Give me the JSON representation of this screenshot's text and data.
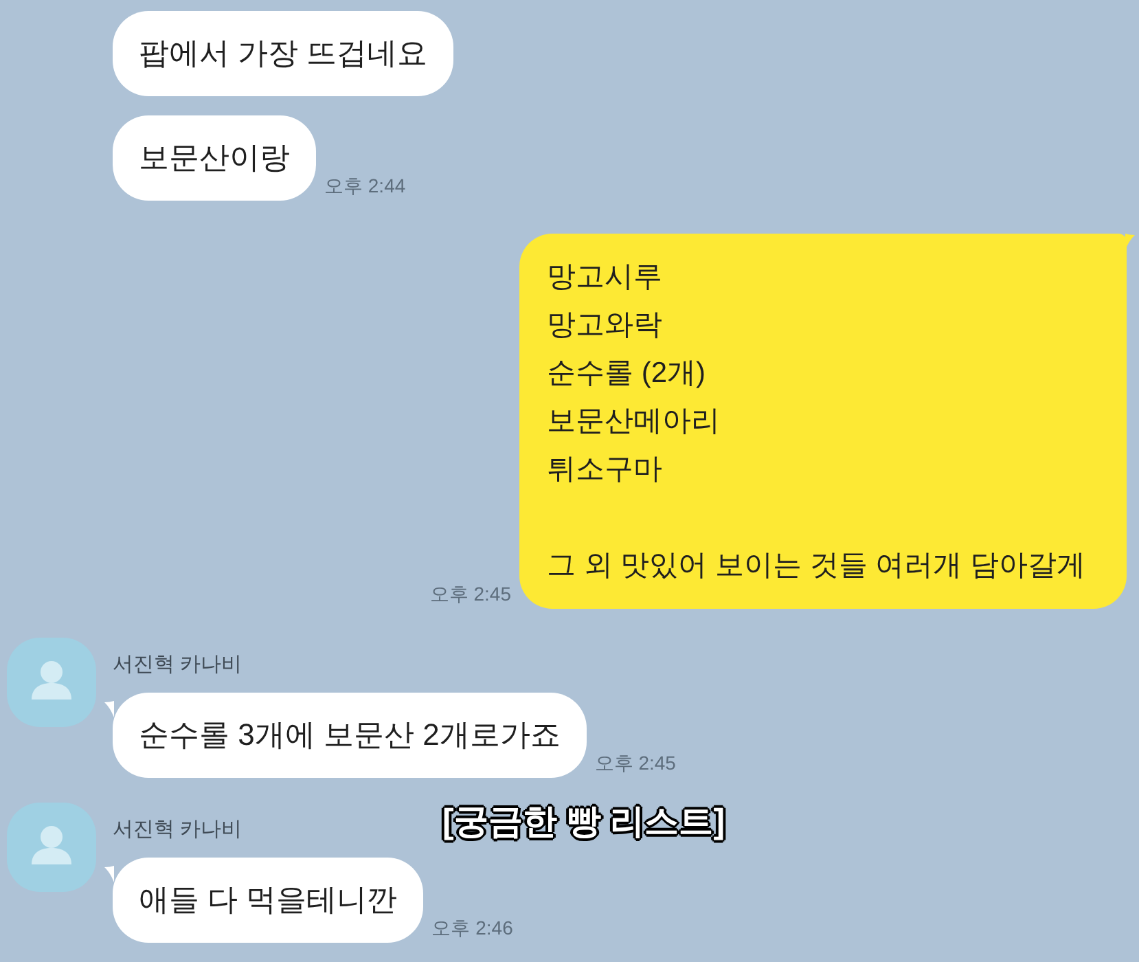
{
  "messages": [
    {
      "kind": "received",
      "text": "팝에서 가장 뜨겁네요"
    },
    {
      "kind": "received",
      "text": "보문산이랑",
      "time": "오후 2:44"
    },
    {
      "kind": "sent",
      "text": "망고시루\n망고와락\n순수롤 (2개)\n보문산메아리\n튀소구마\n\n그 외 맛있어 보이는 것들 여러개 담아갈게",
      "time": "오후 2:45"
    },
    {
      "kind": "received",
      "sender": "서진혁 카나비",
      "text": "순수롤 3개에 보문산 2개로가죠",
      "time": "오후 2:45"
    },
    {
      "kind": "received",
      "sender": "서진혁 카나비",
      "text": "애들 다 먹을테니깐",
      "time": "오후 2:46"
    }
  ],
  "caption": "[궁금한 빵 리스트]"
}
